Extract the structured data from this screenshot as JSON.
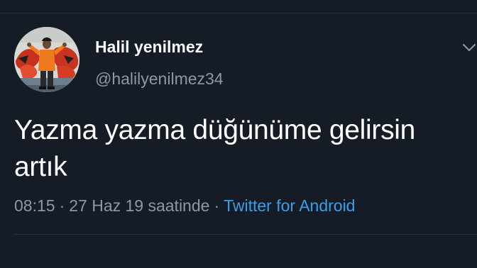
{
  "tweet": {
    "author": {
      "display_name": "Halil yenilmez",
      "handle": "@halilyenilmez34",
      "avatar_icon": "profile-photo"
    },
    "text": "Yazma yazma düğünüme gelirsin artık",
    "time": "08:15",
    "date_text": "27 Haz 19 saatinde",
    "separator": "·",
    "source": "Twitter for Android",
    "menu_icon": "chevron-down-icon"
  },
  "colors": {
    "background": "#151c26",
    "text_primary": "#ffffff",
    "text_secondary": "#8a98a7",
    "link": "#3a9fe8",
    "divider": "#2a3441"
  }
}
